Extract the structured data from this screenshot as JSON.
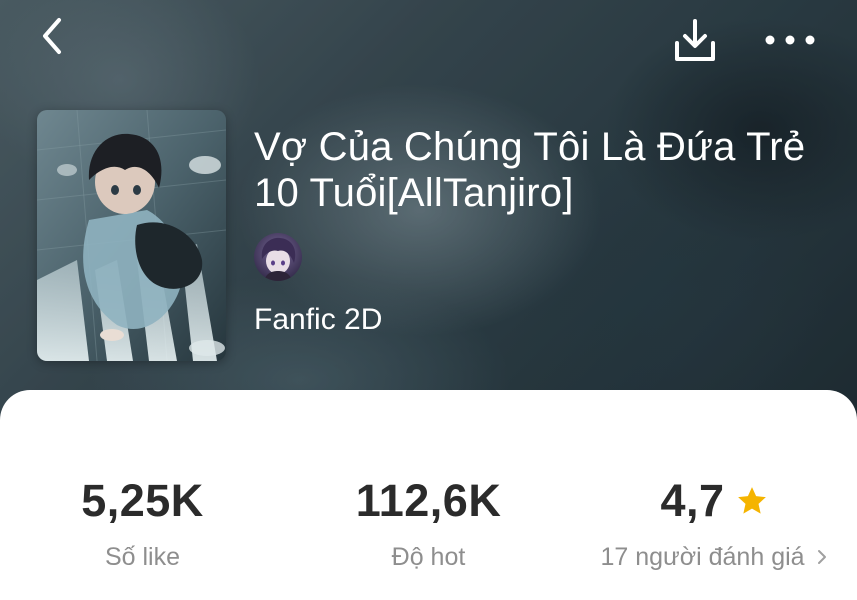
{
  "header": {
    "back_icon": "chevron-left-icon",
    "download_icon": "download-icon",
    "more_icon": "more-horizontal-icon"
  },
  "story": {
    "title": "Vợ Của Chúng Tôi Là Đứa Trẻ 10 Tuổi[AllTanjiro]",
    "genre": "Fanfic 2D"
  },
  "stats": {
    "likes_value": "5,25K",
    "likes_label": "Số like",
    "hot_value": "112,6K",
    "hot_label": "Độ hot",
    "rating_value": "4,7",
    "rating_label": "17 người đánh giá",
    "rating_icon": "star-icon",
    "star_color": "#f5b400"
  }
}
